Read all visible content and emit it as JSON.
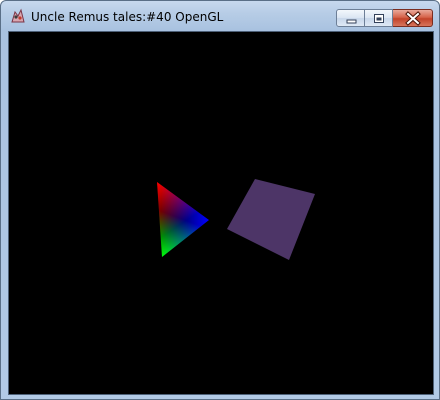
{
  "window": {
    "title": "Uncle Remus tales:#40 OpenGL",
    "app_icon": "application-icon",
    "controls": {
      "minimize_icon": "minimize-icon",
      "maximize_icon": "maximize-icon",
      "close_icon": "close-icon"
    }
  },
  "viewport": {
    "background_color": "#000000",
    "triangle": {
      "vertex_colors": [
        "#ff0000",
        "#00ff00",
        "#0000ff"
      ]
    },
    "quad": {
      "color": "#4d3567"
    }
  }
}
